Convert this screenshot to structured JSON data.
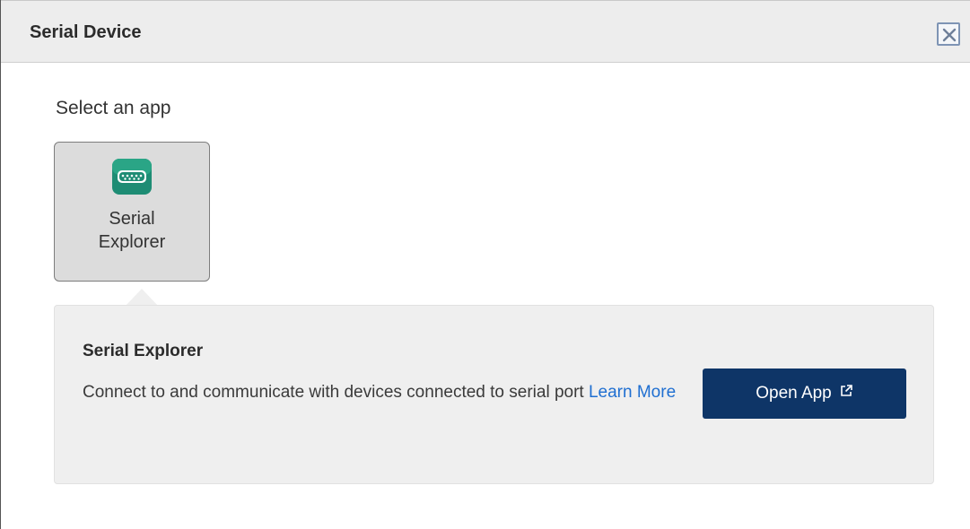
{
  "dialog": {
    "title": "Serial Device"
  },
  "main": {
    "select_label": "Select an app"
  },
  "apps": [
    {
      "label_line1": "Serial",
      "label_line2": "Explorer",
      "icon": "serial-port-icon"
    }
  ],
  "details": {
    "title": "Serial Explorer",
    "description": "Connect to and communicate with devices connected to serial port",
    "learn_more": "Learn More",
    "open_button": "Open App",
    "open_icon": "external-link-icon"
  },
  "colors": {
    "titlebar": "#ededed",
    "button_bg": "#0e3567",
    "link": "#1f6fd1",
    "icon_green": "#1e8c74"
  }
}
